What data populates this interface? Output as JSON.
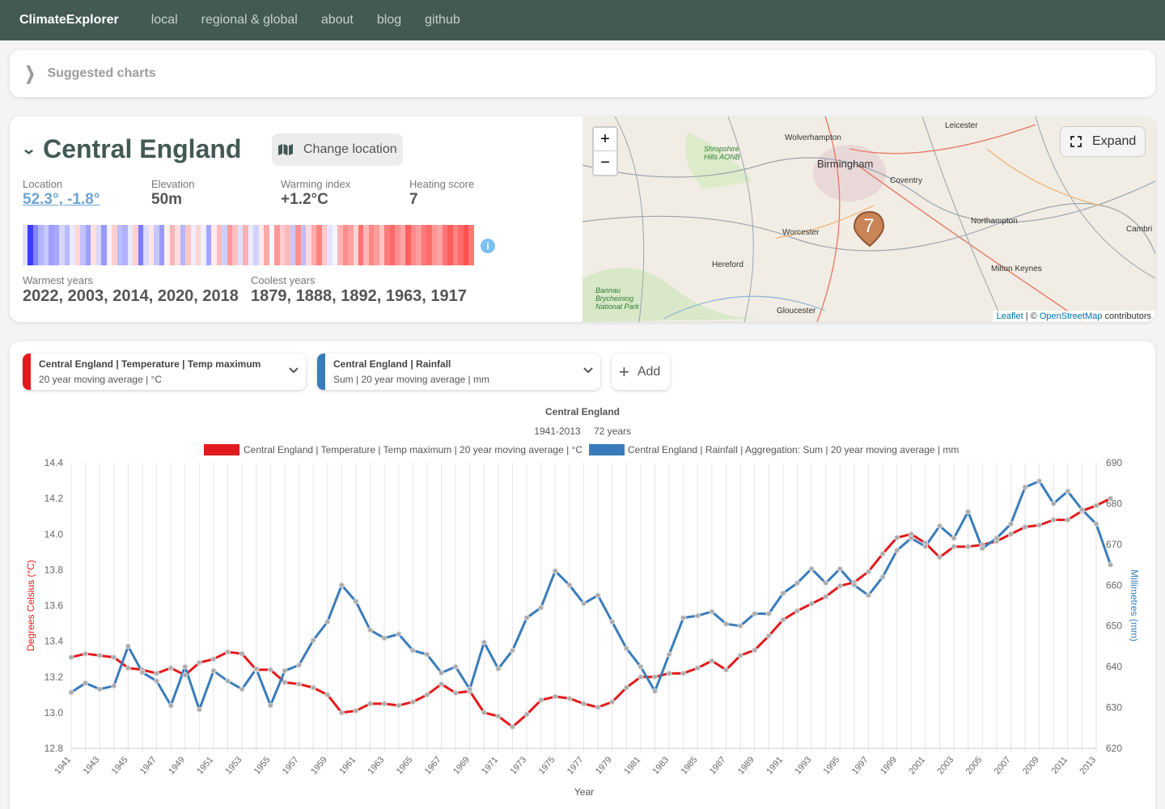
{
  "nav": {
    "brand": "ClimateExplorer",
    "links": [
      "local",
      "regional & global",
      "about",
      "blog",
      "github"
    ]
  },
  "suggested": {
    "label": "Suggested charts"
  },
  "location": {
    "title": "Central England",
    "change_button": "Change location",
    "stats": [
      {
        "label": "Location",
        "value": "52.3°, -1.8°"
      },
      {
        "label": "Elevation",
        "value": "50m"
      },
      {
        "label": "Warming index",
        "value": "+1.2°C"
      },
      {
        "label": "Heating score",
        "value": "7"
      }
    ],
    "warmest_label": "Warmest years",
    "warmest_value": "2022, 2003, 2014, 2020, 2018",
    "coolest_label": "Coolest years",
    "coolest_value": "1879, 1888, 1892, 1963, 1917",
    "info_glyph": "i"
  },
  "map": {
    "zoom_in": "+",
    "zoom_out": "−",
    "expand_label": "Expand",
    "marker_label": "7",
    "attribution_leaflet": "Leaflet",
    "attribution_sep": " | © ",
    "attribution_osm": "OpenStreetMap",
    "attribution_tail": " contributors",
    "places": [
      "Leicester",
      "Wolverhampton",
      "Birmingham",
      "Coventry",
      "Shropshire Hills AONB",
      "Northampton",
      "Worcester",
      "Hereford",
      "Milton Keynes",
      "Cambri",
      "Gloucester",
      "Bannau Brycheiniog National Park"
    ]
  },
  "selectors": [
    {
      "title": "Central England | Temperature | Temp maximum",
      "subtitle": "20 year moving average | °C",
      "color": "#e31a1c"
    },
    {
      "title": "Central England | Rainfall",
      "subtitle": "Sum | 20 year moving average | mm",
      "color": "#3a7cbb"
    }
  ],
  "add_button": "Add",
  "chart_data": {
    "type": "line",
    "title": "Central England",
    "subtitle_range": "1941-2013",
    "subtitle_years": "72 years",
    "xlabel": "Year",
    "ylabel_left": "Degrees Celsius (°C)",
    "ylabel_right": "Millimetres (mm)",
    "ylim_left": [
      12.8,
      14.4
    ],
    "ylim_right": [
      620,
      690
    ],
    "yticks_left": [
      "14.4",
      "14.2",
      "14.0",
      "13.8",
      "13.6",
      "13.4",
      "13.2",
      "13.0",
      "12.8"
    ],
    "yticks_right": [
      "690",
      "680",
      "670",
      "660",
      "650",
      "640",
      "630",
      "620"
    ],
    "legend_placement": "top",
    "grid": true,
    "x": [
      1941,
      1942,
      1943,
      1944,
      1945,
      1946,
      1947,
      1948,
      1949,
      1950,
      1951,
      1952,
      1953,
      1954,
      1955,
      1956,
      1957,
      1958,
      1959,
      1960,
      1961,
      1962,
      1963,
      1964,
      1965,
      1966,
      1967,
      1968,
      1969,
      1970,
      1971,
      1972,
      1973,
      1974,
      1975,
      1976,
      1977,
      1978,
      1979,
      1980,
      1981,
      1982,
      1983,
      1984,
      1985,
      1986,
      1987,
      1988,
      1989,
      1990,
      1991,
      1992,
      1993,
      1994,
      1995,
      1996,
      1997,
      1998,
      1999,
      2000,
      2001,
      2002,
      2003,
      2004,
      2005,
      2006,
      2007,
      2008,
      2009,
      2010,
      2011,
      2012,
      2013
    ],
    "series": [
      {
        "name": "Central England | Temperature | Temp maximum | 20 year moving average | °C",
        "color": "#e31a1c",
        "axis": "left",
        "values": [
          13.31,
          13.33,
          13.32,
          13.31,
          13.25,
          13.24,
          13.22,
          13.25,
          13.21,
          13.28,
          13.3,
          13.34,
          13.33,
          13.24,
          13.24,
          13.17,
          13.16,
          13.14,
          13.1,
          13.0,
          13.01,
          13.05,
          13.05,
          13.04,
          13.06,
          13.1,
          13.16,
          13.11,
          13.12,
          13.0,
          12.98,
          12.92,
          12.99,
          13.07,
          13.09,
          13.08,
          13.05,
          13.03,
          13.06,
          13.14,
          13.2,
          13.2,
          13.22,
          13.22,
          13.25,
          13.29,
          13.24,
          13.32,
          13.35,
          13.43,
          13.52,
          13.57,
          13.61,
          13.65,
          13.71,
          13.73,
          13.79,
          13.89,
          13.98,
          14.0,
          13.95,
          13.87,
          13.93,
          13.93,
          13.94,
          13.96,
          14.0,
          14.04,
          14.05,
          14.08,
          14.08,
          14.13,
          14.16,
          14.2
        ]
      },
      {
        "name": "Central England | Rainfall | Aggregation: Sum | 20 year moving average | mm",
        "color": "#3a7cbb",
        "axis": "right",
        "values": [
          633.7,
          636.0,
          634.5,
          635.3,
          645.0,
          638.6,
          636.5,
          630.5,
          640.0,
          629.5,
          639.0,
          636.5,
          634.5,
          639.5,
          630.5,
          639.0,
          640.4,
          646.5,
          651.0,
          660.0,
          656.0,
          649.0,
          647.0,
          648.0,
          644.0,
          643.0,
          638.5,
          640.0,
          634.5,
          646.0,
          639.5,
          644.0,
          652.0,
          654.5,
          663.5,
          660.0,
          655.5,
          657.5,
          651.0,
          644.5,
          640.0,
          634.0,
          643.0,
          652.0,
          652.5,
          653.5,
          650.5,
          650.0,
          653.0,
          653.0,
          658.0,
          660.5,
          664.0,
          660.5,
          664.0,
          660.0,
          657.5,
          662.0,
          668.5,
          671.5,
          669.5,
          674.5,
          671.5,
          678.0,
          669.0,
          671.5,
          675.0,
          684.0,
          685.5,
          680.0,
          683.0,
          678.5,
          675.0,
          665.0
        ]
      }
    ]
  },
  "stripe_colors": [
    "#e3e3ff",
    "#3d3dff",
    "#8585ff",
    "#b3b3ff",
    "#c9c9ff",
    "#9e9eff",
    "#a8a8ff",
    "#d6d6ff",
    "#b9b9ff",
    "#eaeaff",
    "#ffd6d6",
    "#c2c2ff",
    "#a0a0ff",
    "#ffe0e0",
    "#d9d9ff",
    "#9898ff",
    "#f2f2ff",
    "#ffd0d0",
    "#bebeff",
    "#b0b0ff",
    "#e8e8ff",
    "#ffcfcf",
    "#7a7aff",
    "#dcdcff",
    "#ffe6e6",
    "#c6c6ff",
    "#9a9aff",
    "#ffefef",
    "#f5b6b6",
    "#ffdede",
    "#b6b6ff",
    "#ffc5c5",
    "#ededff",
    "#ffd3d3",
    "#f0f0ff",
    "#a5a5ff",
    "#ffeaea",
    "#ffbcbc",
    "#cfcfff",
    "#ff9a9a",
    "#ffc0c0",
    "#e0e0ff",
    "#ffb0b0",
    "#ececff",
    "#d2d2ff",
    "#ffe9e9",
    "#ffa8a8",
    "#f7f7ff",
    "#ff9999",
    "#ffcccc",
    "#ffb8b8",
    "#c8c8ff",
    "#ff9090",
    "#bdbdff",
    "#ffd9d9",
    "#ffacac",
    "#ff8080",
    "#ffc8c8",
    "#e4e4ff",
    "#f4f4ff",
    "#ffb4b4",
    "#ff8c8c",
    "#ffa0a0",
    "#ffd3d3",
    "#ff7070",
    "#ffb7b7",
    "#ff8888",
    "#ff9c9c",
    "#ffc4c4",
    "#ff7c7c",
    "#ff6868",
    "#ff8e8e",
    "#ffa6a6",
    "#ff6060",
    "#ff8a8a",
    "#ff9e9e",
    "#ff7a7a",
    "#ff6c6c",
    "#ff9696",
    "#ffa4a4",
    "#ff7474",
    "#ff5c5c",
    "#ff8484",
    "#ff6a6a",
    "#ff5050",
    "#ff7878"
  ]
}
